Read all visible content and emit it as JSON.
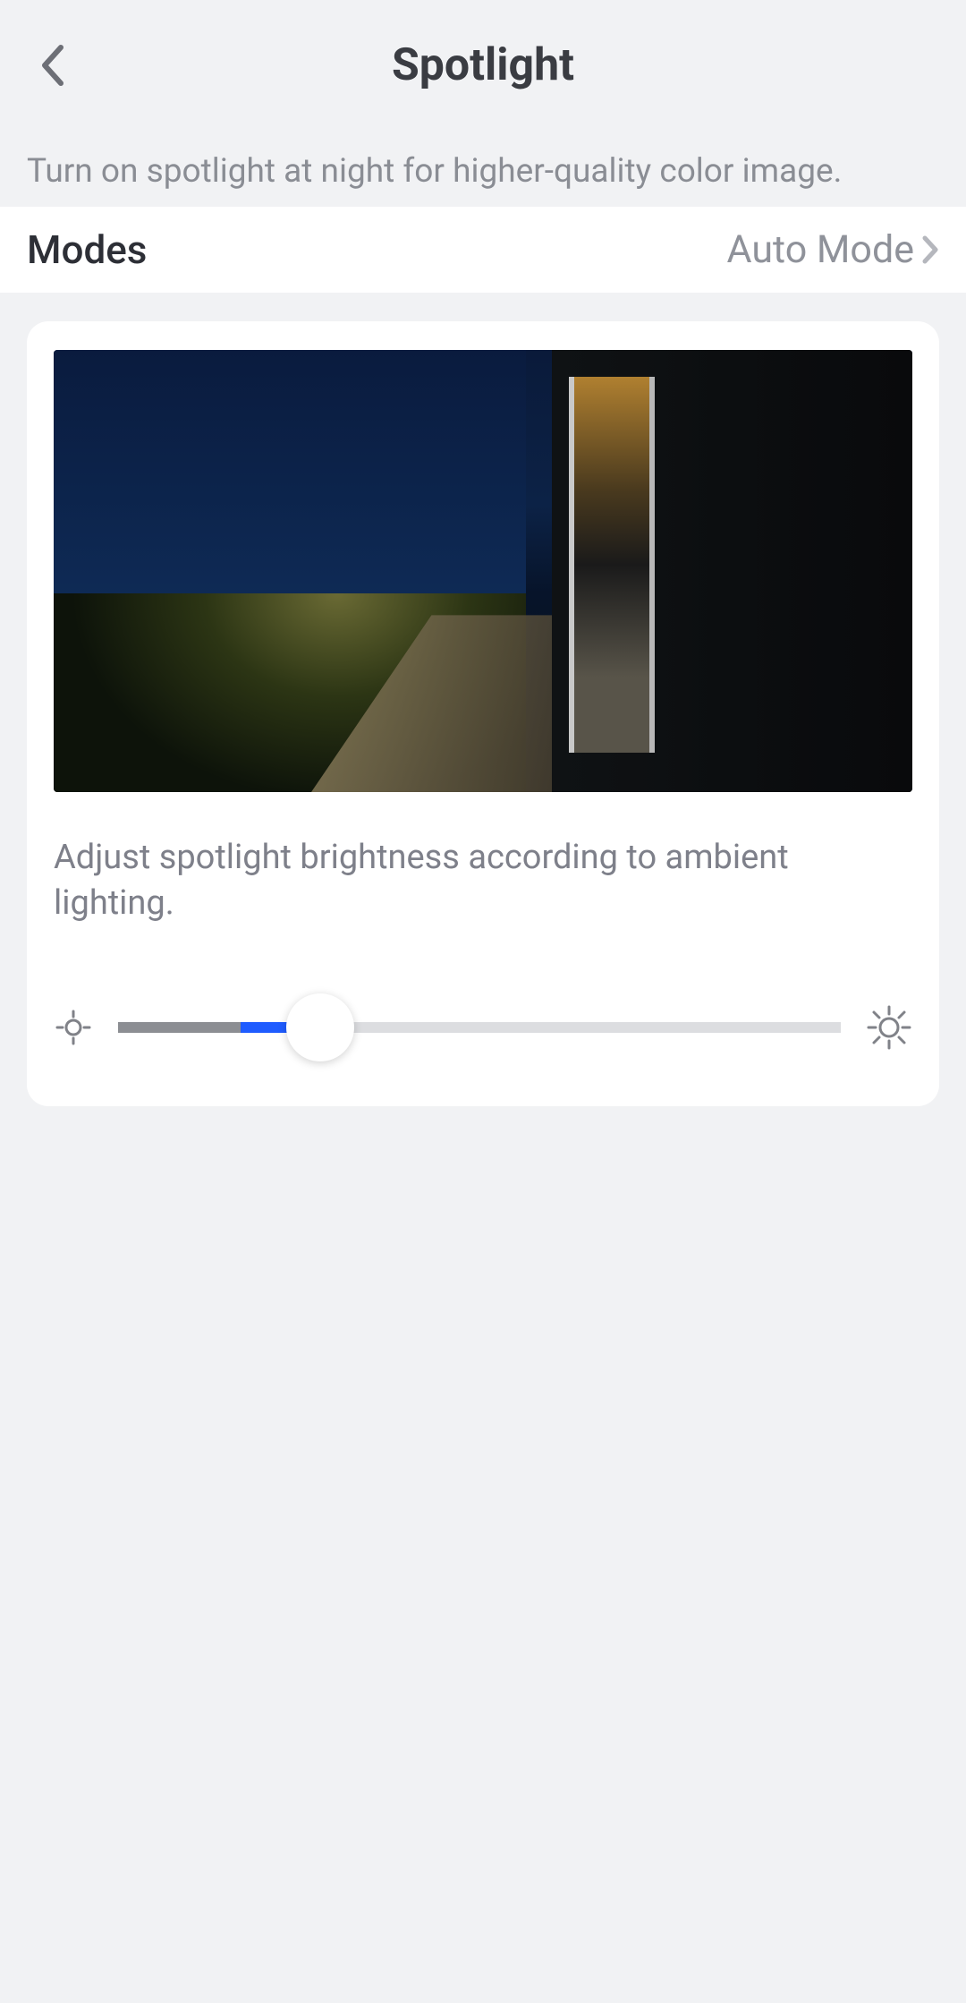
{
  "header": {
    "title": "Spotlight"
  },
  "subtitle": "Turn on spotlight at night for higher-quality color image.",
  "modes_row": {
    "label": "Modes",
    "value": "Auto Mode"
  },
  "card": {
    "description": "Adjust spotlight brightness according to ambient lighting."
  },
  "slider": {
    "value_percent": 28,
    "dark_segment_percent": 17
  },
  "colors": {
    "accent_blue": "#1f5cff",
    "track_dark": "#8c8e93",
    "track_light": "#dcdde0"
  }
}
